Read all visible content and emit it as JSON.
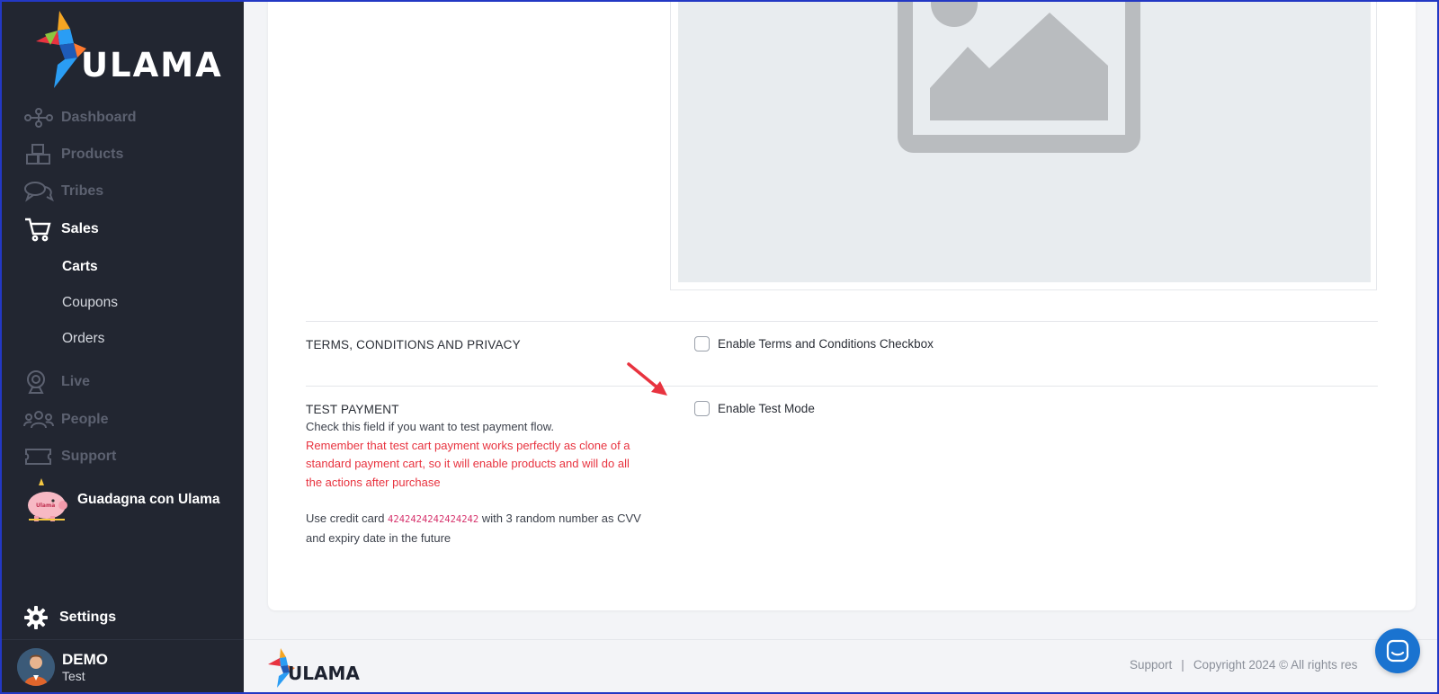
{
  "brand": {
    "name": "ULAMA"
  },
  "sidebar": {
    "items": [
      {
        "label": "Dashboard",
        "icon": "network-icon",
        "active": false
      },
      {
        "label": "Products",
        "icon": "boxes-icon",
        "active": false
      },
      {
        "label": "Tribes",
        "icon": "chat-bubbles-icon",
        "active": false
      },
      {
        "label": "Sales",
        "icon": "cart-icon",
        "active": true
      },
      {
        "label": "Live",
        "icon": "webcam-icon",
        "active": false
      },
      {
        "label": "People",
        "icon": "people-icon",
        "active": false
      },
      {
        "label": "Support",
        "icon": "ticket-icon",
        "active": false
      }
    ],
    "sales_sub": [
      {
        "label": "Carts",
        "active": true
      },
      {
        "label": "Coupons",
        "active": false
      },
      {
        "label": "Orders",
        "active": false
      }
    ],
    "promo": {
      "label": "Guadagna con Ulama",
      "icon": "piggy-bank-icon"
    },
    "settings": {
      "label": "Settings",
      "icon": "gear-icon"
    },
    "user": {
      "name": "DEMO",
      "role": "Test"
    }
  },
  "form": {
    "terms": {
      "title": "TERMS, CONDITIONS AND PRIVACY",
      "checkbox_label": "Enable Terms and Conditions Checkbox",
      "checked": false
    },
    "test_payment": {
      "title": "TEST PAYMENT",
      "checkbox_label": "Enable Test Mode",
      "checked": false,
      "desc_line": "Check this field if you want to test payment flow.",
      "warning": "Remember that test cart payment works perfectly as clone of a standard payment cart, so it will enable products and will do all the actions after purchase",
      "card_prefix": "Use credit card",
      "card_number": "4242424242424242",
      "card_suffix": "with 3 random number as CVV and expiry date in the future"
    }
  },
  "footer": {
    "support_label": "Support",
    "separator": "|",
    "copyright": "Copyright 2024 © All rights res"
  },
  "colors": {
    "sidebar_bg": "#222631",
    "accent_blue": "#1a73d0",
    "warning_red": "#e8333f",
    "code_pink": "#d6336c"
  }
}
